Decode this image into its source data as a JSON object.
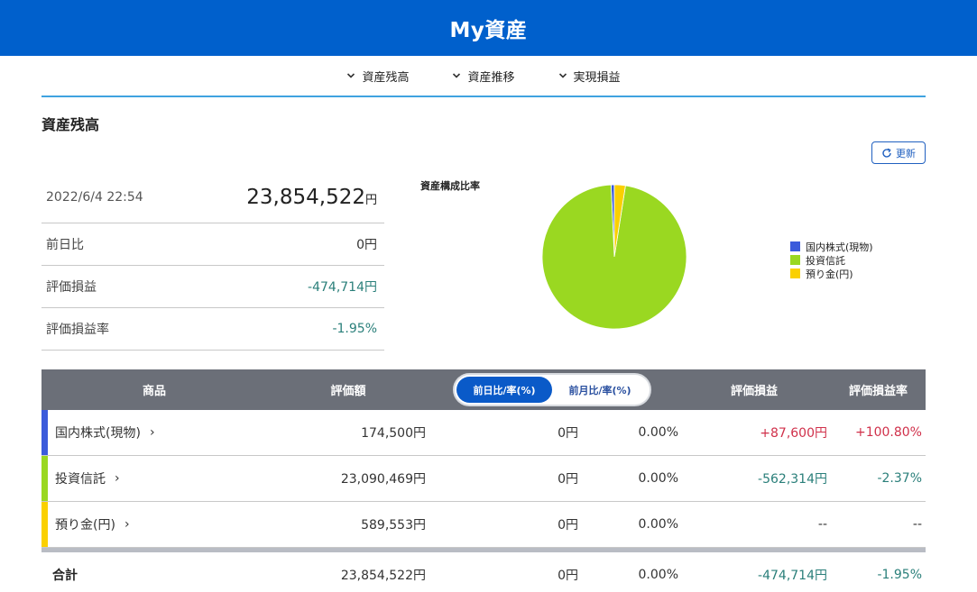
{
  "header": {
    "title": "My資産"
  },
  "nav": [
    {
      "label": "資産残高",
      "icon": "chevron-down-icon"
    },
    {
      "label": "資産推移",
      "icon": "chevron-down-icon"
    },
    {
      "label": "実現損益",
      "icon": "chevron-down-icon"
    }
  ],
  "section_title": "資産残高",
  "refresh_label": "更新",
  "summary": {
    "datetime": "2022/6/4 22:54",
    "total": "23,854,522",
    "total_unit": "円",
    "rows": [
      {
        "label": "前日比",
        "value": "0円"
      },
      {
        "label": "評価損益",
        "value": "-474,714円"
      },
      {
        "label": "評価損益率",
        "value": "-1.95%"
      }
    ]
  },
  "chart_data": {
    "type": "pie",
    "title": "資産構成比率",
    "categories": [
      "国内株式(現物)",
      "投資信託",
      "預り金(円)"
    ],
    "values": [
      174500,
      23090469,
      589553
    ],
    "colors": [
      "#3b5bdb",
      "#9ad821",
      "#fad000"
    ],
    "legend_position": "right"
  },
  "table": {
    "headers": {
      "product": "商品",
      "valuation": "評価額",
      "toggle_day": "前日比/率(%)",
      "toggle_month": "前月比/率(%)",
      "pl": "評価損益",
      "pl_rate": "評価損益率"
    },
    "rows": [
      {
        "name": "国内株式(現物)",
        "value": "174,500円",
        "day_change": "0円",
        "day_rate": "0.00%",
        "pl": "+87,600円",
        "pl_rate": "+100.80%",
        "color": "#3b5bdb",
        "tone": "pos"
      },
      {
        "name": "投資信託",
        "value": "23,090,469円",
        "day_change": "0円",
        "day_rate": "0.00%",
        "pl": "-562,314円",
        "pl_rate": "-2.37%",
        "color": "#9ad821",
        "tone": "neg"
      },
      {
        "name": "預り金(円)",
        "value": "589,553円",
        "day_change": "0円",
        "day_rate": "0.00%",
        "pl": "--",
        "pl_rate": "--",
        "color": "#fad000",
        "tone": "none"
      }
    ],
    "total": {
      "label": "合計",
      "value": "23,854,522円",
      "day_change": "0円",
      "day_rate": "0.00%",
      "pl": "-474,714円",
      "pl_rate": "-1.95%"
    }
  }
}
